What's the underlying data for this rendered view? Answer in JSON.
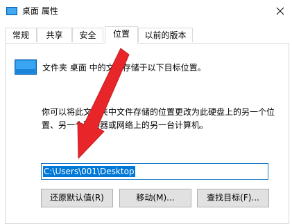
{
  "window": {
    "title": "桌面 属性",
    "close_glyph": "✕"
  },
  "tabs": [
    {
      "label": "常规"
    },
    {
      "label": "共享"
    },
    {
      "label": "安全"
    },
    {
      "label": "位置",
      "active": true
    },
    {
      "label": "以前的版本"
    }
  ],
  "location": {
    "description": "文件夹 桌面 中的文件存储于以下目标位置。",
    "note": "你可以将此文件夹中文件存储的位置更改为此硬盘上的另一个位置、另一个驱动器或网络上的另一台计算机。",
    "path_value": "C:\\Users\\001\\Desktop"
  },
  "buttons": {
    "restore": "还原默认值(R)",
    "move": "移动(M)...",
    "find_target": "查找目标(F)..."
  },
  "colors": {
    "accent": "#0078d7",
    "annotation_arrow": "#e8262a",
    "folder_icon": "#1e90e6"
  },
  "icons": {
    "title": "desktop-folder-icon",
    "folder": "desktop-folder-icon",
    "close": "close-icon"
  }
}
